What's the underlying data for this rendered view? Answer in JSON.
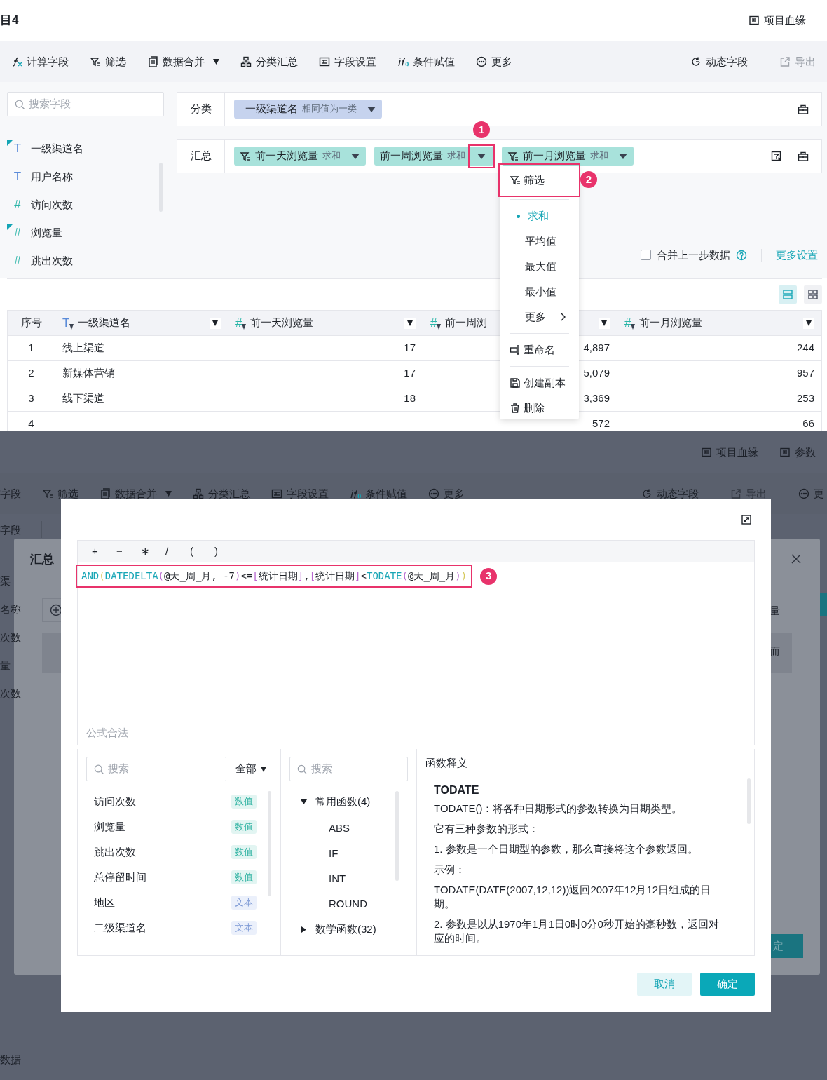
{
  "top": {
    "header": {
      "title": "目4",
      "links": [
        {
          "label": "项目血缘"
        }
      ]
    },
    "toolbar": {
      "left": [
        {
          "label": "计算字段",
          "dropdown": false,
          "disabled": false
        },
        {
          "label": "筛选",
          "dropdown": false,
          "disabled": false
        },
        {
          "label": "数据合并",
          "dropdown": true,
          "disabled": false
        },
        {
          "label": "分类汇总",
          "dropdown": false,
          "disabled": false
        },
        {
          "label": "字段设置",
          "dropdown": false,
          "disabled": false
        },
        {
          "label": "条件赋值",
          "dropdown": false,
          "disabled": false
        },
        {
          "label": "更多",
          "dropdown": false,
          "disabled": false
        }
      ],
      "right": [
        {
          "label": "动态字段",
          "dropdown": false,
          "disabled": false
        },
        {
          "label": "导出",
          "dropdown": false,
          "disabled": true
        }
      ]
    },
    "field_search": {
      "placeholder": "搜索字段"
    },
    "fields": [
      {
        "name": "一级渠道名",
        "kind": "text",
        "type_mark": "T",
        "marked": true
      },
      {
        "name": "用户名称",
        "kind": "text",
        "type_mark": "T",
        "marked": false
      },
      {
        "name": "访问次数",
        "kind": "number",
        "type_mark": "#",
        "marked": false
      },
      {
        "name": "浏览量",
        "kind": "number",
        "type_mark": "#",
        "marked": true
      },
      {
        "name": "跳出次数",
        "kind": "number",
        "type_mark": "#",
        "marked": false
      }
    ],
    "category_row": {
      "label": "分类",
      "chips": [
        {
          "name": "一级渠道名",
          "note": "相同值为一类",
          "kind": "dimension",
          "filtered": false,
          "highlighted": false
        }
      ]
    },
    "summary_row": {
      "label": "汇总",
      "chips": [
        {
          "name": "前一天浏览量",
          "note": "求和",
          "kind": "measure",
          "filtered": true,
          "highlighted": false
        },
        {
          "name": "前一周浏览量",
          "note": "求和",
          "kind": "measure",
          "filtered": false,
          "highlighted": true,
          "callout": "1"
        },
        {
          "name": "前一月浏览量",
          "note": "求和",
          "kind": "measure",
          "filtered": true,
          "highlighted": false
        }
      ]
    },
    "merge_option": {
      "label": "合并上一步数据",
      "checked": false
    },
    "more_settings": "更多设置",
    "view_modes": [
      {
        "kind": "list",
        "selected": true
      },
      {
        "kind": "grid",
        "selected": false
      }
    ],
    "table": {
      "columns": [
        {
          "label": "序号"
        },
        {
          "label": "一级渠道名",
          "kind": "text",
          "type_mark": "T"
        },
        {
          "label": "前一天浏览量",
          "kind": "number",
          "type_mark": "#"
        },
        {
          "label": "前一周浏",
          "kind": "number",
          "type_mark": "#"
        },
        {
          "label": "前一月浏览量",
          "kind": "number",
          "type_mark": "#"
        }
      ],
      "rows": [
        [
          "1",
          "线上渠道",
          "17",
          "4,897",
          "244"
        ],
        [
          "2",
          "新媒体营销",
          "17",
          "5,079",
          "957"
        ],
        [
          "3",
          "线下渠道",
          "18",
          "3,369",
          "253"
        ],
        [
          "4",
          null,
          null,
          "572",
          "66"
        ]
      ]
    },
    "column_menu": {
      "items": [
        {
          "kind": "action",
          "label": "筛选",
          "highlighted": true,
          "callout": "2"
        },
        {
          "kind": "divider"
        },
        {
          "kind": "option",
          "label": "求和",
          "selected": true
        },
        {
          "kind": "option",
          "label": "平均值",
          "selected": false
        },
        {
          "kind": "option",
          "label": "最大值",
          "selected": false
        },
        {
          "kind": "option",
          "label": "最小值",
          "selected": false
        },
        {
          "kind": "submenu",
          "label": "更多"
        },
        {
          "kind": "divider"
        },
        {
          "kind": "action",
          "label": "重命名",
          "highlighted": false
        },
        {
          "kind": "divider"
        },
        {
          "kind": "action",
          "label": "创建副本",
          "highlighted": false
        },
        {
          "kind": "action",
          "label": "删除",
          "highlighted": false
        }
      ]
    }
  },
  "bottom": {
    "background": {
      "header_links": [
        {
          "label": "项目血缘"
        },
        {
          "label": "参数"
        }
      ],
      "toolbar_left": [
        {
          "label": "字段",
          "dropdown": false,
          "disabled": false
        },
        {
          "label": "筛选",
          "dropdown": false,
          "disabled": false
        },
        {
          "label": "数据合并",
          "dropdown": true,
          "disabled": false
        },
        {
          "label": "分类汇总",
          "dropdown": false,
          "disabled": false
        },
        {
          "label": "字段设置",
          "dropdown": false,
          "disabled": false
        },
        {
          "label": "条件赋值",
          "dropdown": false,
          "disabled": false
        },
        {
          "label": "更多",
          "dropdown": false,
          "disabled": false
        }
      ],
      "toolbar_right": [
        {
          "label": "动态字段",
          "dropdown": false,
          "disabled": false
        },
        {
          "label": "导出",
          "dropdown": false,
          "disabled": true
        },
        {
          "label": "更",
          "dropdown": false,
          "disabled": false
        }
      ],
      "search_placeholder": "字段",
      "side_fragments": [
        "渠",
        "名称",
        "次数",
        "量",
        "次数"
      ],
      "footer_text": "数据"
    },
    "back_dialog": {
      "title": "汇总",
      "fragments": [
        "量",
        "而"
      ],
      "confirm": "定"
    },
    "formula_dialog": {
      "operators": [
        "+",
        "−",
        "∗",
        "/",
        "(",
        ")"
      ],
      "formula": {
        "highlighted": true,
        "callout": "3",
        "tokens": [
          {
            "kind": "function",
            "text": "AND"
          },
          {
            "kind": "paren",
            "text": "(",
            "color": "#d6c95c"
          },
          {
            "kind": "function",
            "text": "DATEDELTA"
          },
          {
            "kind": "paren",
            "text": "(",
            "color": "#b768d0"
          },
          {
            "kind": "plain",
            "text": "@天_周_月, -7"
          },
          {
            "kind": "paren",
            "text": ")",
            "color": "#b768d0"
          },
          {
            "kind": "plain",
            "text": "<="
          },
          {
            "kind": "paren",
            "text": "[",
            "color": "#b768d0"
          },
          {
            "kind": "plain",
            "text": "统计日期"
          },
          {
            "kind": "paren",
            "text": "]",
            "color": "#b768d0"
          },
          {
            "kind": "plain",
            "text": ","
          },
          {
            "kind": "paren",
            "text": "[",
            "color": "#b768d0"
          },
          {
            "kind": "plain",
            "text": "统计日期"
          },
          {
            "kind": "paren",
            "text": "]",
            "color": "#b768d0"
          },
          {
            "kind": "plain",
            "text": "<"
          },
          {
            "kind": "function",
            "text": "TODATE"
          },
          {
            "kind": "paren",
            "text": "(",
            "color": "#b768d0"
          },
          {
            "kind": "plain",
            "text": "@天_周_月"
          },
          {
            "kind": "paren",
            "text": ")",
            "color": "#b768d0"
          },
          {
            "kind": "paren",
            "text": ")",
            "color": "#d6c95c"
          }
        ]
      },
      "status": "公式合法",
      "field_search": {
        "placeholder": "搜索"
      },
      "field_filter": "全部",
      "fields": [
        {
          "name": "访问次数",
          "tag": "数值",
          "kind": "number"
        },
        {
          "name": "浏览量",
          "tag": "数值",
          "kind": "number"
        },
        {
          "name": "跳出次数",
          "tag": "数值",
          "kind": "number"
        },
        {
          "name": "总停留时间",
          "tag": "数值",
          "kind": "number"
        },
        {
          "name": "地区",
          "tag": "文本",
          "kind": "text"
        },
        {
          "name": "二级渠道名",
          "tag": "文本",
          "kind": "text"
        }
      ],
      "function_search": {
        "placeholder": "搜索"
      },
      "function_tree": [
        {
          "label": "常用函数(4)",
          "expanded": true,
          "children": [
            {
              "label": "ABS"
            },
            {
              "label": "IF"
            },
            {
              "label": "INT"
            },
            {
              "label": "ROUND"
            }
          ]
        },
        {
          "label": "数学函数(32)",
          "expanded": false
        }
      ],
      "help": {
        "heading": "函数释义",
        "name": "TODATE",
        "paragraphs": [
          "TODATE()：将各种日期形式的参数转换为日期类型。",
          "它有三种参数的形式：",
          "1. 参数是一个日期型的参数，那么直接将这个参数返回。",
          "示例：",
          "TODATE(DATE(2007,12,12))返回2007年12月12日组成的日期。",
          "2. 参数是以从1970年1月1日0时0分0秒开始的毫秒数，返回对应的时间。"
        ]
      },
      "buttons": [
        {
          "label": "取消",
          "kind": "secondary"
        },
        {
          "label": "确定",
          "kind": "primary"
        }
      ]
    }
  }
}
